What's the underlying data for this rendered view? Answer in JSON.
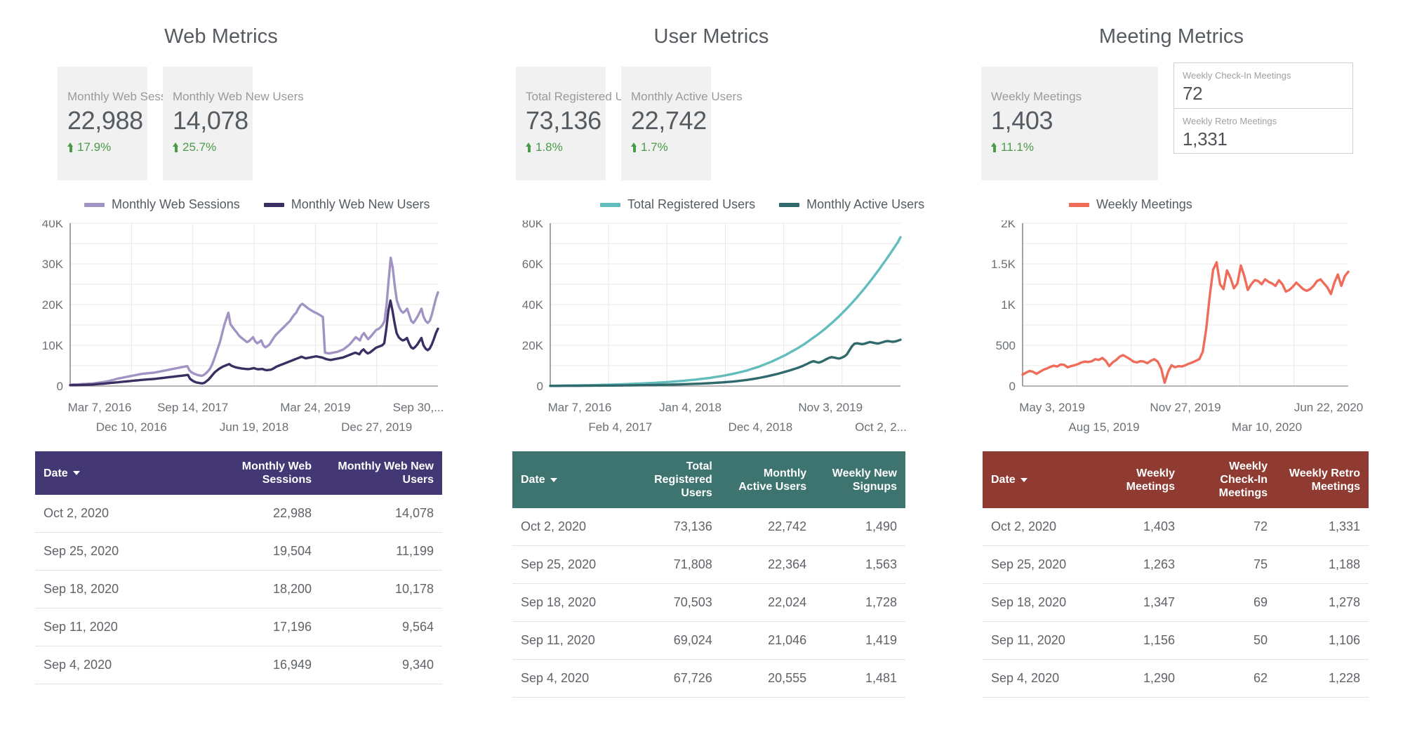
{
  "panels": [
    {
      "title": "Web Metrics",
      "scorecards": [
        {
          "label": "Monthly Web Sessions",
          "value": "22,988",
          "delta": "17.9%"
        },
        {
          "label": "Monthly Web New Users",
          "value": "14,078",
          "delta": "25.7%"
        }
      ],
      "legend": [
        {
          "label": "Monthly Web Sessions",
          "color": "#a193c4"
        },
        {
          "label": "Monthly Web New Users",
          "color": "#3b2e63"
        }
      ],
      "table": {
        "headers": [
          "Date",
          "Monthly Web Sessions",
          "Monthly Web New Users"
        ],
        "header_color": "#433874",
        "rows": [
          [
            "Oct 2, 2020",
            "22,988",
            "14,078"
          ],
          [
            "Sep 25, 2020",
            "19,504",
            "11,199"
          ],
          [
            "Sep 18, 2020",
            "18,200",
            "10,178"
          ],
          [
            "Sep 11, 2020",
            "17,196",
            "9,564"
          ],
          [
            "Sep 4, 2020",
            "16,949",
            "9,340"
          ]
        ]
      }
    },
    {
      "title": "User Metrics",
      "scorecards": [
        {
          "label": "Total Registered Users",
          "value": "73,136",
          "delta": "1.8%"
        },
        {
          "label": "Monthly Active Users",
          "value": "22,742",
          "delta": "1.7%"
        }
      ],
      "legend": [
        {
          "label": "Total Registered Users",
          "color": "#63bdbd"
        },
        {
          "label": "Monthly Active Users",
          "color": "#316a6c"
        }
      ],
      "table": {
        "headers": [
          "Date",
          "Total Registered Users",
          "Monthly Active Users",
          "Weekly New Signups"
        ],
        "header_color": "#3e7470",
        "rows": [
          [
            "Oct 2, 2020",
            "73,136",
            "22,742",
            "1,490"
          ],
          [
            "Sep 25, 2020",
            "71,808",
            "22,364",
            "1,563"
          ],
          [
            "Sep 18, 2020",
            "70,503",
            "22,024",
            "1,728"
          ],
          [
            "Sep 11, 2020",
            "69,024",
            "21,046",
            "1,419"
          ],
          [
            "Sep 4, 2020",
            "67,726",
            "20,555",
            "1,481"
          ]
        ]
      }
    },
    {
      "title": "Meeting Metrics",
      "scorecards": [
        {
          "label": "Weekly Meetings",
          "value": "1,403",
          "delta": "11.1%"
        }
      ],
      "mini_cards": [
        {
          "label": "Weekly Check-In Meetings",
          "value": "72"
        },
        {
          "label": "Weekly Retro Meetings",
          "value": "1,331"
        }
      ],
      "legend": [
        {
          "label": "Weekly Meetings",
          "color": "#ef6c5a"
        }
      ],
      "table": {
        "headers": [
          "Date",
          "Weekly Meetings",
          "Weekly Check-In Meetings",
          "Weekly Retro Meetings"
        ],
        "header_color": "#8f3b32",
        "rows": [
          [
            "Oct 2, 2020",
            "1,403",
            "72",
            "1,331"
          ],
          [
            "Sep 25, 2020",
            "1,263",
            "75",
            "1,188"
          ],
          [
            "Sep 18, 2020",
            "1,347",
            "69",
            "1,278"
          ],
          [
            "Sep 11, 2020",
            "1,156",
            "50",
            "1,106"
          ],
          [
            "Sep 4, 2020",
            "1,290",
            "62",
            "1,228"
          ]
        ]
      }
    }
  ],
  "chart_data": [
    {
      "type": "line",
      "title": "Web Metrics",
      "xlabel": "",
      "ylabel": "",
      "ylim": [
        0,
        40000
      ],
      "yticks": [
        "0",
        "10K",
        "20K",
        "30K",
        "40K"
      ],
      "xticks": [
        "Mar 7, 2016",
        "Dec 10, 2016",
        "Sep 14, 2017",
        "Jun 19, 2018",
        "Mar 24, 2019",
        "Dec 27, 2019",
        "Sep 30,..."
      ],
      "grid": true,
      "legend_position": "top",
      "series": [
        {
          "name": "Monthly Web Sessions",
          "color": "#a193c4",
          "values": [
            300,
            350,
            400,
            380,
            420,
            450,
            500,
            480,
            520,
            560,
            600,
            640,
            700,
            760,
            820,
            900,
            980,
            1050,
            1150,
            1250,
            1400,
            1500,
            1650,
            1800,
            1900,
            2000,
            2100,
            2200,
            2300,
            2400,
            2500,
            2600,
            2700,
            2800,
            2900,
            3000,
            3050,
            3100,
            3150,
            3200,
            3250,
            3300,
            3400,
            3500,
            3600,
            3700,
            3800,
            3900,
            4000,
            4100,
            4200,
            4300,
            4400,
            4500,
            4600,
            4700,
            4800,
            4900,
            3900,
            3400,
            3100,
            2900,
            2700,
            2600,
            2500,
            2700,
            3100,
            3600,
            4200,
            5200,
            6500,
            8000,
            9500,
            11000,
            13000,
            15000,
            16500,
            18000,
            15200,
            14500,
            13800,
            13200,
            12500,
            12000,
            11600,
            11200,
            10800,
            11000,
            11500,
            12000,
            11000,
            10500,
            10800,
            11200,
            10000,
            9500,
            9800,
            10200,
            11000,
            11800,
            12500,
            13000,
            13500,
            14000,
            14500,
            15000,
            15500,
            16000,
            16800,
            17500,
            18000,
            19000,
            19800,
            20200,
            19800,
            19400,
            19000,
            18700,
            18400,
            18100,
            17900,
            17600,
            17300,
            17000,
            8200,
            8100,
            8000,
            8100,
            8200,
            8300,
            8400,
            8600,
            8800,
            9000,
            9400,
            9800,
            10200,
            10800,
            11400,
            12000,
            11600,
            11200,
            12400,
            13000,
            12200,
            11500,
            12000,
            12600,
            13200,
            13800,
            14000,
            14400,
            15000,
            16000,
            20000,
            26000,
            31500,
            29000,
            24500,
            21000,
            19500,
            18500,
            18000,
            18400,
            19000,
            17500,
            16000,
            15500,
            16200,
            17000,
            18000,
            19000,
            17000,
            16000,
            15500,
            16000,
            17500,
            19500,
            21500,
            22988
          ]
        },
        {
          "name": "Monthly Web New Users",
          "color": "#3b2e63",
          "values": [
            200,
            220,
            240,
            230,
            250,
            270,
            290,
            300,
            320,
            340,
            360,
            380,
            420,
            460,
            500,
            540,
            580,
            620,
            680,
            720,
            780,
            820,
            880,
            920,
            980,
            1020,
            1080,
            1120,
            1180,
            1220,
            1280,
            1320,
            1380,
            1420,
            1480,
            1520,
            1560,
            1600,
            1640,
            1680,
            1720,
            1760,
            1820,
            1880,
            1940,
            2000,
            2060,
            2120,
            2180,
            2240,
            2300,
            2360,
            2420,
            2480,
            2540,
            2600,
            2660,
            2720,
            1800,
            1400,
            1100,
            900,
            800,
            700,
            650,
            800,
            1200,
            1600,
            2200,
            2800,
            3400,
            3800,
            4200,
            4500,
            4800,
            5000,
            5200,
            5400,
            5000,
            4800,
            4600,
            4500,
            4400,
            4300,
            4250,
            4200,
            4150,
            4200,
            4300,
            4400,
            4200,
            4100,
            4150,
            4200,
            4000,
            3900,
            3950,
            4000,
            4200,
            4500,
            4800,
            5000,
            5200,
            5400,
            5600,
            5800,
            6000,
            6200,
            6400,
            6600,
            6800,
            7000,
            7200,
            7000,
            6800,
            6900,
            7000,
            7100,
            7200,
            7300,
            7200,
            7100,
            7000,
            6800,
            6600,
            6500,
            6400,
            6500,
            6600,
            6700,
            6800,
            6900,
            7000,
            7200,
            7400,
            7600,
            7800,
            8000,
            8200,
            8000,
            7800,
            8600,
            9000,
            8400,
            8000,
            8200,
            8600,
            9000,
            9400,
            9600,
            9800,
            10000,
            10500,
            14000,
            18500,
            21000,
            18500,
            15500,
            13000,
            12000,
            11500,
            11200,
            11400,
            11800,
            10500,
            9500,
            9200,
            9600,
            10200,
            11000,
            11800,
            10000,
            9200,
            8800,
            9200,
            10200,
            11500,
            13000,
            14078
          ]
        }
      ]
    },
    {
      "type": "line",
      "title": "User Metrics",
      "xlabel": "",
      "ylabel": "",
      "ylim": [
        0,
        80000
      ],
      "yticks": [
        "0",
        "20K",
        "40K",
        "60K",
        "80K"
      ],
      "xticks": [
        "Mar 7, 2016",
        "Feb 4, 2017",
        "Jan 4, 2018",
        "Dec 4, 2018",
        "Nov 3, 2019",
        "Oct 2, 2..."
      ],
      "grid": true,
      "legend_position": "top",
      "series": [
        {
          "name": "Total Registered Users",
          "color": "#63bdbd",
          "values": [
            120,
            140,
            160,
            180,
            200,
            220,
            240,
            260,
            280,
            300,
            320,
            340,
            360,
            380,
            400,
            420,
            450,
            480,
            510,
            540,
            570,
            600,
            640,
            680,
            720,
            760,
            800,
            840,
            880,
            920,
            960,
            1000,
            1060,
            1120,
            1180,
            1240,
            1300,
            1360,
            1420,
            1480,
            1540,
            1600,
            1680,
            1760,
            1840,
            1920,
            2000,
            2100,
            2200,
            2300,
            2400,
            2500,
            2620,
            2740,
            2860,
            2980,
            3100,
            3250,
            3400,
            3550,
            3700,
            3850,
            4000,
            4200,
            4400,
            4600,
            4800,
            5000,
            5250,
            5500,
            5750,
            6000,
            6300,
            6600,
            6900,
            7200,
            7500,
            7900,
            8300,
            8700,
            9100,
            9500,
            10000,
            10500,
            11000,
            11500,
            12000,
            12600,
            13200,
            13800,
            14400,
            15000,
            15700,
            16400,
            17100,
            17800,
            18500,
            19300,
            20100,
            20900,
            21800,
            22700,
            23600,
            24500,
            25400,
            26400,
            27400,
            28400,
            29500,
            30600,
            31700,
            32900,
            34100,
            35300,
            36600,
            37900,
            39200,
            40600,
            42000,
            43400,
            44900,
            46400,
            47900,
            49500,
            51100,
            52700,
            54400,
            56100,
            57800,
            59600,
            61400,
            63200,
            65000,
            66900,
            68800,
            70700,
            73136
          ]
        },
        {
          "name": "Monthly Active Users",
          "color": "#316a6c",
          "values": [
            60,
            70,
            80,
            85,
            90,
            95,
            100,
            105,
            110,
            115,
            120,
            125,
            130,
            140,
            150,
            160,
            170,
            180,
            190,
            200,
            210,
            220,
            230,
            240,
            250,
            260,
            275,
            290,
            305,
            320,
            335,
            350,
            365,
            380,
            400,
            420,
            440,
            460,
            480,
            500,
            520,
            540,
            565,
            590,
            615,
            640,
            670,
            700,
            730,
            760,
            800,
            840,
            880,
            920,
            960,
            1000,
            1050,
            1100,
            1150,
            1200,
            1260,
            1320,
            1380,
            1450,
            1520,
            1600,
            1680,
            1760,
            1850,
            1950,
            2050,
            2150,
            2280,
            2400,
            2550,
            2700,
            2850,
            3000,
            3200,
            3400,
            3600,
            3800,
            4050,
            4300,
            4550,
            4800,
            5100,
            5400,
            5700,
            6000,
            6350,
            6700,
            7050,
            7400,
            7800,
            8200,
            8600,
            9000,
            9500,
            10000,
            10600,
            11200,
            11800,
            12200,
            11800,
            11500,
            11900,
            12500,
            13200,
            13800,
            14200,
            14000,
            13700,
            13500,
            13900,
            14500,
            15500,
            17500,
            19500,
            20800,
            21000,
            20800,
            20600,
            20800,
            21200,
            21600,
            21400,
            21100,
            20900,
            21100,
            21500,
            21900,
            22100,
            21900,
            21700,
            21900,
            22300,
            22742
          ]
        }
      ]
    },
    {
      "type": "line",
      "title": "Meeting Metrics",
      "xlabel": "",
      "ylabel": "",
      "ylim": [
        0,
        2000
      ],
      "yticks": [
        "0",
        "500",
        "1K",
        "1.5K",
        "2K"
      ],
      "xticks": [
        "May 3, 2019",
        "Aug 15, 2019",
        "Nov 27, 2019",
        "Mar 10, 2020",
        "Jun 22, 2020"
      ],
      "grid": true,
      "legend_position": "top",
      "series": [
        {
          "name": "Weekly Meetings",
          "color": "#ef6c5a",
          "values": [
            140,
            165,
            185,
            175,
            150,
            175,
            200,
            215,
            235,
            250,
            240,
            265,
            260,
            230,
            245,
            255,
            270,
            290,
            300,
            295,
            305,
            330,
            320,
            345,
            310,
            245,
            290,
            320,
            360,
            380,
            355,
            330,
            300,
            290,
            305,
            300,
            280,
            310,
            330,
            300,
            215,
            40,
            175,
            255,
            230,
            245,
            240,
            255,
            275,
            290,
            310,
            330,
            420,
            700,
            1100,
            1430,
            1520,
            1250,
            1190,
            1420,
            1330,
            1200,
            1260,
            1480,
            1350,
            1180,
            1250,
            1300,
            1290,
            1250,
            1310,
            1280,
            1260,
            1230,
            1300,
            1250,
            1160,
            1180,
            1220,
            1270,
            1230,
            1190,
            1170,
            1190,
            1230,
            1290,
            1310,
            1260,
            1210,
            1130,
            1270,
            1370,
            1230,
            1350,
            1403
          ]
        }
      ]
    }
  ]
}
